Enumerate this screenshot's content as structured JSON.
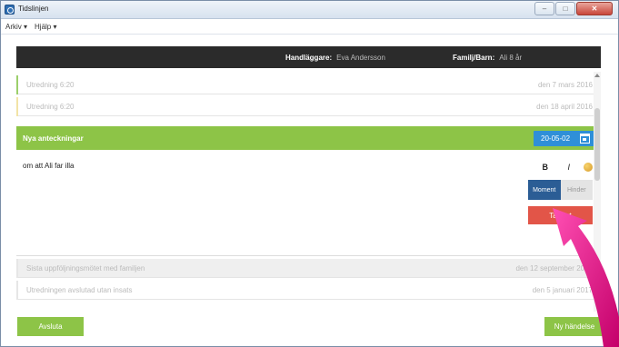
{
  "window": {
    "title": "Tidslinjen"
  },
  "menu": [
    {
      "label": "Arkiv ▾"
    },
    {
      "label": "Hjälp ▾"
    }
  ],
  "header": {
    "handlaggare_label": "Handläggare:",
    "handlaggare_value": "Eva Andersson",
    "familj_label": "Familj/Barn:",
    "familj_value": "Ali 8 år"
  },
  "timeline": {
    "top_rows": [
      {
        "title": "Utredning 6:20",
        "date": "den 7 mars 2016",
        "accent": "#9ccf6b"
      },
      {
        "title": "Utredning 6:20",
        "date": "den 18 april 2016",
        "accent": "#f2e4a6"
      }
    ],
    "editor": {
      "title": "Nya anteckningar",
      "date": "20-05-02",
      "text": "om att Ali far illa",
      "bold_label": "B",
      "italic_label": "I",
      "toggle_left": "Moment",
      "toggle_right": "Hinder",
      "delete_label": "Ta bort"
    },
    "bottom_rows": [
      {
        "title": "Sista uppföljningsmötet med familjen",
        "date": "den 12 september 2016",
        "accent": "#e6e6e6"
      },
      {
        "title": "Utredningen avslutad utan insats",
        "date": "den 5 januari 2017",
        "accent": "#e6e6e6"
      }
    ]
  },
  "footer": {
    "left_button": "Avsluta",
    "right_button": "Ny händelse"
  },
  "colors": {
    "accent_green": "#8dc447",
    "header_dark": "#2b2b2b",
    "date_blue": "#2f8fd8",
    "delete_red": "#e25548",
    "pointer_pink": "#e0007a"
  }
}
